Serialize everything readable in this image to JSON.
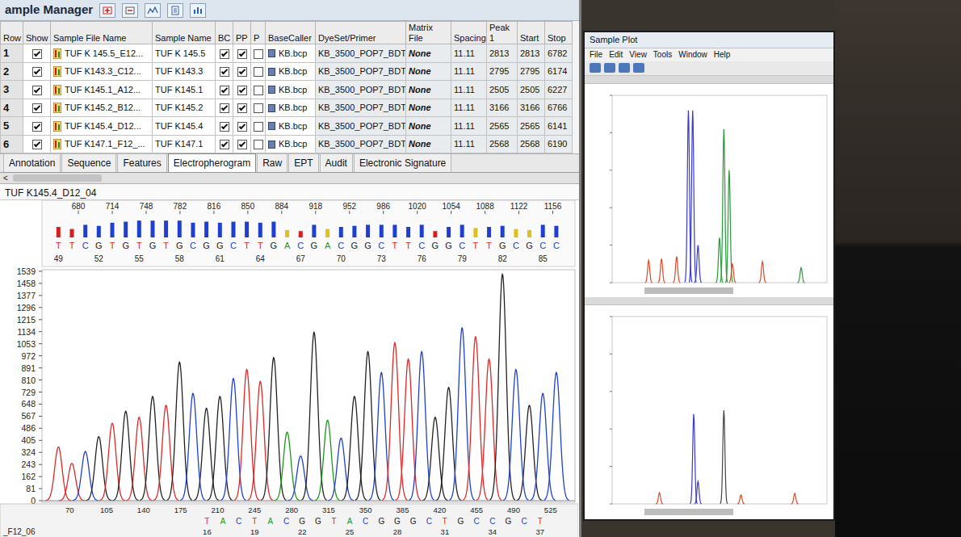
{
  "window": {
    "title": "ample Manager"
  },
  "table": {
    "columns": [
      "Row",
      "Show",
      "Sample File Name",
      "Sample Name",
      "BC",
      "PP",
      "P",
      "BaseCaller",
      "DyeSet/Primer",
      "Matrix File",
      "Spacing",
      "Peak 1",
      "Start",
      "Stop"
    ],
    "rows": [
      {
        "row": "1",
        "show": true,
        "file": "TUF K 145.5_E12...",
        "sample": "TUF K 145.5",
        "bc": true,
        "pp": true,
        "p": false,
        "basecaller": "KB.bcp",
        "dyeset": "KB_3500_POP7_BDT",
        "matrix": "None",
        "spacing": "11.11",
        "peak1": "2813",
        "start": "2813",
        "stop": "6782"
      },
      {
        "row": "2",
        "show": true,
        "file": "TUF K143.3_C12...",
        "sample": "TUF K143.3",
        "bc": true,
        "pp": true,
        "p": false,
        "basecaller": "KB.bcp",
        "dyeset": "KB_3500_POP7_BDT",
        "matrix": "None",
        "spacing": "11.11",
        "peak1": "2795",
        "start": "2795",
        "stop": "6174"
      },
      {
        "row": "3",
        "show": true,
        "file": "TUF K145.1_A12...",
        "sample": "TUF K145.1",
        "bc": true,
        "pp": true,
        "p": false,
        "basecaller": "KB.bcp",
        "dyeset": "KB_3500_POP7_BDT",
        "matrix": "None",
        "spacing": "11.11",
        "peak1": "2505",
        "start": "2505",
        "stop": "6227"
      },
      {
        "row": "4",
        "show": true,
        "file": "TUF K145.2_B12...",
        "sample": "TUF K145.2",
        "bc": true,
        "pp": true,
        "p": false,
        "basecaller": "KB.bcp",
        "dyeset": "KB_3500_POP7_BDT",
        "matrix": "None",
        "spacing": "11.11",
        "peak1": "3166",
        "start": "3166",
        "stop": "6766"
      },
      {
        "row": "5",
        "show": true,
        "file": "TUF K145.4_D12...",
        "sample": "TUF K145.4",
        "bc": true,
        "pp": true,
        "p": false,
        "basecaller": "KB.bcp",
        "dyeset": "KB_3500_POP7_BDT",
        "matrix": "None",
        "spacing": "11.11",
        "peak1": "2565",
        "start": "2565",
        "stop": "6141"
      },
      {
        "row": "6",
        "show": true,
        "file": "TUF K147.1_F12_...",
        "sample": "TUF K147.1",
        "bc": true,
        "pp": true,
        "p": false,
        "basecaller": "KB.bcp",
        "dyeset": "KB_3500_POP7_BDT",
        "matrix": "None",
        "spacing": "11.11",
        "peak1": "2568",
        "start": "2568",
        "stop": "6190"
      }
    ]
  },
  "tabs": [
    {
      "label": "Annotation",
      "selected": false
    },
    {
      "label": "Sequence",
      "selected": false
    },
    {
      "label": "Features",
      "selected": false
    },
    {
      "label": "Electropherogram",
      "selected": true
    },
    {
      "label": "Raw",
      "selected": false
    },
    {
      "label": "EPT",
      "selected": false
    },
    {
      "label": "Audit",
      "selected": false
    },
    {
      "label": "Electronic Signature",
      "selected": false
    }
  ],
  "scroll_glyph": "<",
  "electropherogram": {
    "title": "TUF K145.4_D12_04",
    "y_ticks": [
      "1539",
      "1458",
      "1377",
      "1296",
      "1215",
      "1134",
      "1053",
      "972",
      "891",
      "810",
      "729",
      "648",
      "567",
      "486",
      "405",
      "324",
      "243",
      "162",
      "81",
      "0"
    ],
    "x_ticks": [
      "680",
      "714",
      "748",
      "782",
      "816",
      "850",
      "884",
      "918",
      "952",
      "986",
      "1020",
      "1054",
      "1088",
      "1122",
      "1156"
    ],
    "calls": [
      {
        "base": "T",
        "color": "#e02828",
        "pos": 660,
        "height": 360,
        "level": 0.5,
        "qv_color": "#d62020"
      },
      {
        "base": "T",
        "color": "#e02828",
        "pos": 673.5,
        "height": 250,
        "level": 0.4,
        "qv_color": "#d62020"
      },
      {
        "base": "C",
        "color": "#2040d0",
        "pos": 687,
        "height": 330,
        "level": 0.6,
        "qv_color": "#1f3fd0"
      },
      {
        "base": "G",
        "color": "#222222",
        "pos": 700.5,
        "height": 430,
        "level": 0.55,
        "qv_color": "#1f3fd0"
      },
      {
        "base": "T",
        "color": "#e02828",
        "pos": 714,
        "height": 520,
        "level": 0.7,
        "qv_color": "#1f3fd0"
      },
      {
        "base": "G",
        "color": "#222222",
        "pos": 727.5,
        "height": 600,
        "level": 0.75,
        "qv_color": "#1f3fd0"
      },
      {
        "base": "T",
        "color": "#e02828",
        "pos": 741,
        "height": 560,
        "level": 0.8,
        "qv_color": "#1f3fd0"
      },
      {
        "base": "G",
        "color": "#222222",
        "pos": 754.5,
        "height": 700,
        "level": 0.8,
        "qv_color": "#1f3fd0"
      },
      {
        "base": "T",
        "color": "#e02828",
        "pos": 768,
        "height": 640,
        "level": 0.8,
        "qv_color": "#1f3fd0"
      },
      {
        "base": "G",
        "color": "#222222",
        "pos": 781.5,
        "height": 930,
        "level": 0.8,
        "qv_color": "#1f3fd0"
      },
      {
        "base": "C",
        "color": "#2040d0",
        "pos": 795,
        "height": 720,
        "level": 0.7,
        "qv_color": "#1f3fd0"
      },
      {
        "base": "G",
        "color": "#222222",
        "pos": 808.5,
        "height": 620,
        "level": 0.75,
        "qv_color": "#1f3fd0"
      },
      {
        "base": "G",
        "color": "#222222",
        "pos": 822,
        "height": 700,
        "level": 0.7,
        "qv_color": "#1f3fd0"
      },
      {
        "base": "C",
        "color": "#2040d0",
        "pos": 835.5,
        "height": 820,
        "level": 0.75,
        "qv_color": "#1f3fd0"
      },
      {
        "base": "T",
        "color": "#e02828",
        "pos": 849,
        "height": 880,
        "level": 0.75,
        "qv_color": "#1f3fd0"
      },
      {
        "base": "T",
        "color": "#e02828",
        "pos": 862.5,
        "height": 800,
        "level": 0.7,
        "qv_color": "#1f3fd0"
      },
      {
        "base": "G",
        "color": "#222222",
        "pos": 876,
        "height": 960,
        "level": 0.75,
        "qv_color": "#1f3fd0"
      },
      {
        "base": "A",
        "color": "#1a9a1a",
        "pos": 889.5,
        "height": 460,
        "level": 0.35,
        "qv_color": "#e0c020"
      },
      {
        "base": "C",
        "color": "#2040d0",
        "pos": 903,
        "height": 300,
        "level": 0.3,
        "qv_color": "#d62020"
      },
      {
        "base": "G",
        "color": "#222222",
        "pos": 916.5,
        "height": 1130,
        "level": 0.6,
        "qv_color": "#1f3fd0"
      },
      {
        "base": "A",
        "color": "#1a9a1a",
        "pos": 930,
        "height": 540,
        "level": 0.4,
        "qv_color": "#e0c020"
      },
      {
        "base": "C",
        "color": "#2040d0",
        "pos": 943.5,
        "height": 420,
        "level": 0.5,
        "qv_color": "#1f3fd0"
      },
      {
        "base": "G",
        "color": "#222222",
        "pos": 957,
        "height": 700,
        "level": 0.55,
        "qv_color": "#1f3fd0"
      },
      {
        "base": "G",
        "color": "#222222",
        "pos": 970.5,
        "height": 1000,
        "level": 0.6,
        "qv_color": "#1f3fd0"
      },
      {
        "base": "C",
        "color": "#2040d0",
        "pos": 984,
        "height": 860,
        "level": 0.6,
        "qv_color": "#1f3fd0"
      },
      {
        "base": "T",
        "color": "#e02828",
        "pos": 997.5,
        "height": 1060,
        "level": 0.6,
        "qv_color": "#1f3fd0"
      },
      {
        "base": "T",
        "color": "#e02828",
        "pos": 1011,
        "height": 950,
        "level": 0.5,
        "qv_color": "#1f3fd0"
      },
      {
        "base": "C",
        "color": "#2040d0",
        "pos": 1024.5,
        "height": 1000,
        "level": 0.6,
        "qv_color": "#1f3fd0"
      },
      {
        "base": "G",
        "color": "#222222",
        "pos": 1038,
        "height": 560,
        "level": 0.3,
        "qv_color": "#d62020"
      },
      {
        "base": "G",
        "color": "#222222",
        "pos": 1051.5,
        "height": 760,
        "level": 0.5,
        "qv_color": "#1f3fd0"
      },
      {
        "base": "C",
        "color": "#2040d0",
        "pos": 1065,
        "height": 1160,
        "level": 0.6,
        "qv_color": "#1f3fd0"
      },
      {
        "base": "T",
        "color": "#e02828",
        "pos": 1078.5,
        "height": 1100,
        "level": 0.45,
        "qv_color": "#e0c020"
      },
      {
        "base": "T",
        "color": "#e02828",
        "pos": 1092,
        "height": 950,
        "level": 0.5,
        "qv_color": "#1f3fd0"
      },
      {
        "base": "G",
        "color": "#222222",
        "pos": 1105.5,
        "height": 1520,
        "level": 0.55,
        "qv_color": "#1f3fd0"
      },
      {
        "base": "C",
        "color": "#2040d0",
        "pos": 1119,
        "height": 880,
        "level": 0.4,
        "qv_color": "#e0c020"
      },
      {
        "base": "G",
        "color": "#222222",
        "pos": 1132.5,
        "height": 640,
        "level": 0.35,
        "qv_color": "#e0c020"
      },
      {
        "base": "C",
        "color": "#2040d0",
        "pos": 1146,
        "height": 720,
        "level": 0.6,
        "qv_color": "#1f3fd0"
      },
      {
        "base": "C",
        "color": "#2040d0",
        "pos": 1159.5,
        "height": 860,
        "level": 0.55,
        "qv_color": "#1f3fd0"
      }
    ],
    "base_numbers": [
      {
        "text": "49",
        "pos": 660
      },
      {
        "text": "52",
        "pos": 700.5
      },
      {
        "text": "55",
        "pos": 741
      },
      {
        "text": "58",
        "pos": 781.5
      },
      {
        "text": "61",
        "pos": 822
      },
      {
        "text": "64",
        "pos": 862.5
      },
      {
        "text": "67",
        "pos": 903
      },
      {
        "text": "70",
        "pos": 943.5
      },
      {
        "text": "73",
        "pos": 984
      },
      {
        "text": "76",
        "pos": 1024.5
      },
      {
        "text": "79",
        "pos": 1065
      },
      {
        "text": "82",
        "pos": 1105.5
      },
      {
        "text": "85",
        "pos": 1146
      }
    ]
  },
  "lower_trace": {
    "title": "_F12_06",
    "x_ticks": [
      "70",
      "105",
      "140",
      "175",
      "210",
      "245",
      "280",
      "315",
      "350",
      "385",
      "420",
      "455",
      "490",
      "525"
    ],
    "calls": [
      {
        "base": "T",
        "color": "#e02828",
        "pos": 200
      },
      {
        "base": "A",
        "color": "#1a9a1a",
        "pos": 215
      },
      {
        "base": "C",
        "color": "#2040d0",
        "pos": 230
      },
      {
        "base": "T",
        "color": "#e02828",
        "pos": 245
      },
      {
        "base": "A",
        "color": "#1a9a1a",
        "pos": 260
      },
      {
        "base": "C",
        "color": "#2040d0",
        "pos": 275
      },
      {
        "base": "G",
        "color": "#222222",
        "pos": 290
      },
      {
        "base": "G",
        "color": "#222222",
        "pos": 305
      },
      {
        "base": "T",
        "color": "#e02828",
        "pos": 320
      },
      {
        "base": "A",
        "color": "#1a9a1a",
        "pos": 335
      },
      {
        "base": "C",
        "color": "#2040d0",
        "pos": 350
      },
      {
        "base": "G",
        "color": "#222222",
        "pos": 365
      },
      {
        "base": "G",
        "color": "#222222",
        "pos": 380
      },
      {
        "base": "G",
        "color": "#222222",
        "pos": 395
      },
      {
        "base": "C",
        "color": "#2040d0",
        "pos": 410
      },
      {
        "base": "T",
        "color": "#e02828",
        "pos": 425
      },
      {
        "base": "G",
        "color": "#222222",
        "pos": 440
      },
      {
        "base": "C",
        "color": "#2040d0",
        "pos": 455
      },
      {
        "base": "C",
        "color": "#2040d0",
        "pos": 470
      },
      {
        "base": "G",
        "color": "#222222",
        "pos": 485
      },
      {
        "base": "C",
        "color": "#2040d0",
        "pos": 500
      },
      {
        "base": "T",
        "color": "#e02828",
        "pos": 515
      }
    ],
    "base_numbers": [
      {
        "text": "16",
        "pos": 200
      },
      {
        "text": "19",
        "pos": 245
      },
      {
        "text": "22",
        "pos": 290
      },
      {
        "text": "25",
        "pos": 335
      },
      {
        "text": "28",
        "pos": 380
      },
      {
        "text": "31",
        "pos": 425
      },
      {
        "text": "34",
        "pos": 470
      },
      {
        "text": "37",
        "pos": 515
      }
    ]
  },
  "plot_window": {
    "title": "Sample Plot",
    "menu": [
      "File",
      "Edit",
      "View",
      "Tools",
      "Window",
      "Help"
    ],
    "plots": [
      {
        "peaks": [
          {
            "pos": 0.17,
            "height": 300,
            "color": "#e04a2a"
          },
          {
            "pos": 0.23,
            "height": 320,
            "color": "#e04a2a"
          },
          {
            "pos": 0.3,
            "height": 350,
            "color": "#e04a2a"
          },
          {
            "pos": 0.355,
            "height": 2300,
            "color": "#3a3ad0"
          },
          {
            "pos": 0.375,
            "height": 2300,
            "color": "#3a3ad0"
          },
          {
            "pos": 0.4,
            "height": 500,
            "color": "#3a3ad0"
          },
          {
            "pos": 0.5,
            "height": 600,
            "color": "#2a9a3a"
          },
          {
            "pos": 0.52,
            "height": 2050,
            "color": "#2a9a3a"
          },
          {
            "pos": 0.545,
            "height": 1500,
            "color": "#2a9a3a"
          },
          {
            "pos": 0.56,
            "height": 250,
            "color": "#e04a2a"
          },
          {
            "pos": 0.7,
            "height": 280,
            "color": "#e04a2a"
          },
          {
            "pos": 0.88,
            "height": 200,
            "color": "#2a9a3a"
          }
        ]
      },
      {
        "peaks": [
          {
            "pos": 0.22,
            "height": 150,
            "color": "#e04a2a"
          },
          {
            "pos": 0.38,
            "height": 1200,
            "color": "#3a3ad0"
          },
          {
            "pos": 0.4,
            "height": 300,
            "color": "#3a3ad0"
          },
          {
            "pos": 0.52,
            "height": 1250,
            "color": "#444444"
          },
          {
            "pos": 0.6,
            "height": 120,
            "color": "#e04a2a"
          },
          {
            "pos": 0.85,
            "height": 140,
            "color": "#e04a2a"
          }
        ]
      }
    ]
  }
}
